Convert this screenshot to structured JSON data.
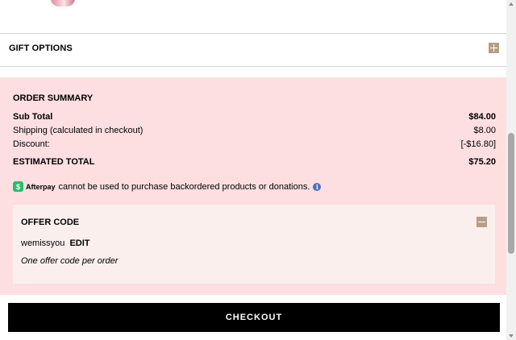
{
  "gift": {
    "title": "GIFT OPTIONS",
    "toggle_icon": "plus-icon"
  },
  "summary": {
    "title": "ORDER SUMMARY",
    "rows": [
      {
        "label": "Sub Total",
        "value": "$84.00"
      },
      {
        "label": "Shipping (calculated in checkout)",
        "value": "$8.00"
      },
      {
        "label": "Discount:",
        "value": "[-$16.80]"
      },
      {
        "label": "ESTIMATED TOTAL",
        "value": "$75.20"
      }
    ]
  },
  "afterpay": {
    "badge": "$",
    "brand": "Afterpay",
    "message": "cannot be used to purchase backordered products or donations.",
    "info": "i"
  },
  "offer": {
    "title": "OFFER CODE",
    "toggle_icon": "minus-icon",
    "code": "wemissyou",
    "edit_label": "EDIT",
    "note": "One offer code per order"
  },
  "checkout": {
    "label": "CHECKOUT"
  },
  "colors": {
    "summary_bg": "#fddfe1",
    "offer_bg": "#fbefee",
    "toggle_bg": "#b59e86",
    "afterpay_green": "#26c06a",
    "checkout_bg": "#000000"
  }
}
